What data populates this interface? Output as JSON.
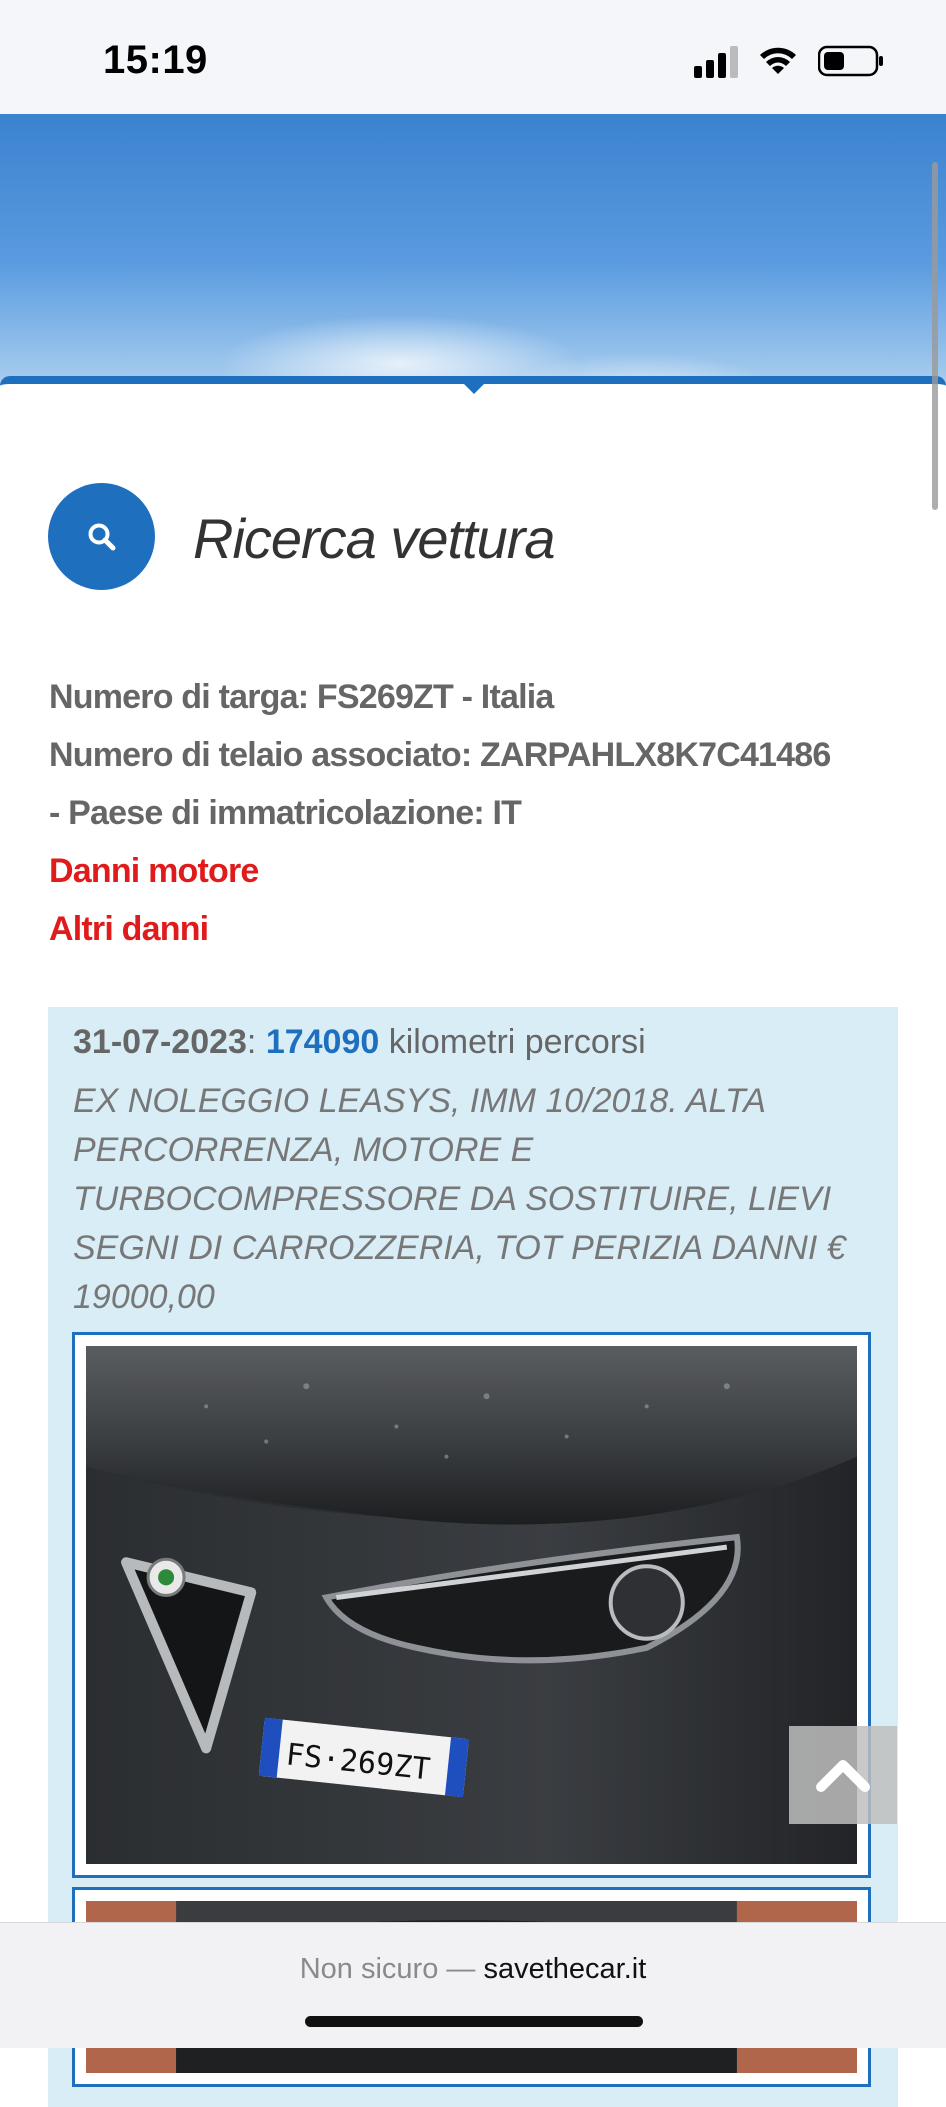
{
  "status_bar": {
    "time": "15:19"
  },
  "search": {
    "title": "Ricerca vettura",
    "icon": "search-icon"
  },
  "vehicle": {
    "plate_line": "Numero di targa: FS269ZT - Italia",
    "chassis_line": "Numero di telaio associato: ZARPAHLX8K7C41486",
    "country_line": "- Paese di immatricolazione: IT",
    "damage_engine": "Danni motore",
    "damage_other": "Altri danni"
  },
  "record": {
    "date": "31-07-2023",
    "separator": ":",
    "km": "174090",
    "km_label": "kilometri percorsi",
    "description": "EX NOLEGGIO LEASYS, IMM 10/2018. ALTA PERCORRENZA, MOTORE E TURBOCOMPRESSORE DA SOSTITUIRE, LIEVI SEGNI DI CARROZZERIA, TOT PERIZIA DANNI € 19000,00",
    "photo_plate_text": "FS·269ZT"
  },
  "browser": {
    "security": "Non sicuro —",
    "domain": "savethecar.it"
  },
  "colors": {
    "accent": "#1f6fbf",
    "damage_red": "#e01b1b",
    "record_bg": "#d9edf7"
  }
}
